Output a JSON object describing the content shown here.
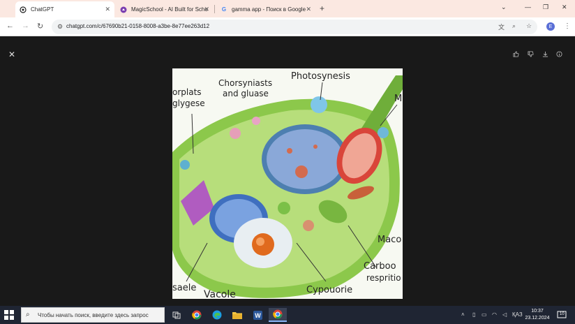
{
  "browser": {
    "tabs": [
      {
        "title": "ChatGPT",
        "icon": "chatgpt-icon"
      },
      {
        "title": "MagicSchool - AI Built for Scho",
        "icon": "magicschool-icon"
      },
      {
        "title": "gamma app - Поиск в Google",
        "icon": "google-icon"
      }
    ],
    "new_tab": "+",
    "window_controls": [
      "⌄",
      "—",
      "❐",
      "✕"
    ],
    "url": "chatgpt.com/c/67690b21-0158-8008-a3be-8e77ee263d12",
    "profile_initial": "E"
  },
  "viewer": {
    "close": "✕",
    "actions": [
      "like-icon",
      "dislike-icon",
      "download-icon",
      "info-icon"
    ]
  },
  "image": {
    "labels": {
      "top_center": "Photosynesis",
      "top_left_1": "Chorsyniasts",
      "top_left_2": "and gluase",
      "left_1": "orplats",
      "left_2": "glygese",
      "right_top": "M",
      "right_mid": "Maco",
      "right_low_1": "Carboo",
      "right_low_2": "respritio",
      "bottom_left": "saele",
      "bottom_mid": "Vacole",
      "bottom_right": "Cypouorie"
    }
  },
  "taskbar": {
    "search_placeholder": "Чтобы начать поиск, введите здесь запрос",
    "language": "ҚАЗ",
    "time": "10:37",
    "date": "23.12.2024",
    "notifications": "10"
  }
}
